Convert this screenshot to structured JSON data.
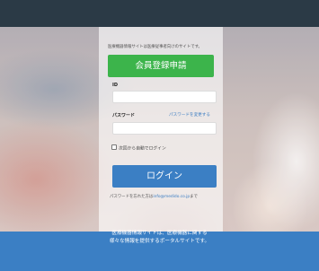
{
  "panel": {
    "notice": "医療機器情報サイトは医療従事者向けのサイトです。",
    "register_label": "会員登録申請",
    "id_label": "ID",
    "id_value": "",
    "password_label": "パスワード",
    "forgot_label": "パスワードを変更する",
    "password_value": "",
    "auto_login_label": "次回から自動でログイン",
    "login_label": "ログイン",
    "help_prefix": "パスワードを忘れた方は",
    "help_email": "info@medido.co.jp",
    "help_suffix": "まで"
  },
  "footer": {
    "line1": "医療機器情報サイトは、医療機器に関する",
    "line2": "様々な情報を提供するポータルサイトです。"
  },
  "colors": {
    "register_button": "#3cb44b",
    "login_button": "#3b7fc4",
    "footer": "#3b7fc4",
    "topbar": "#2b3a46"
  }
}
